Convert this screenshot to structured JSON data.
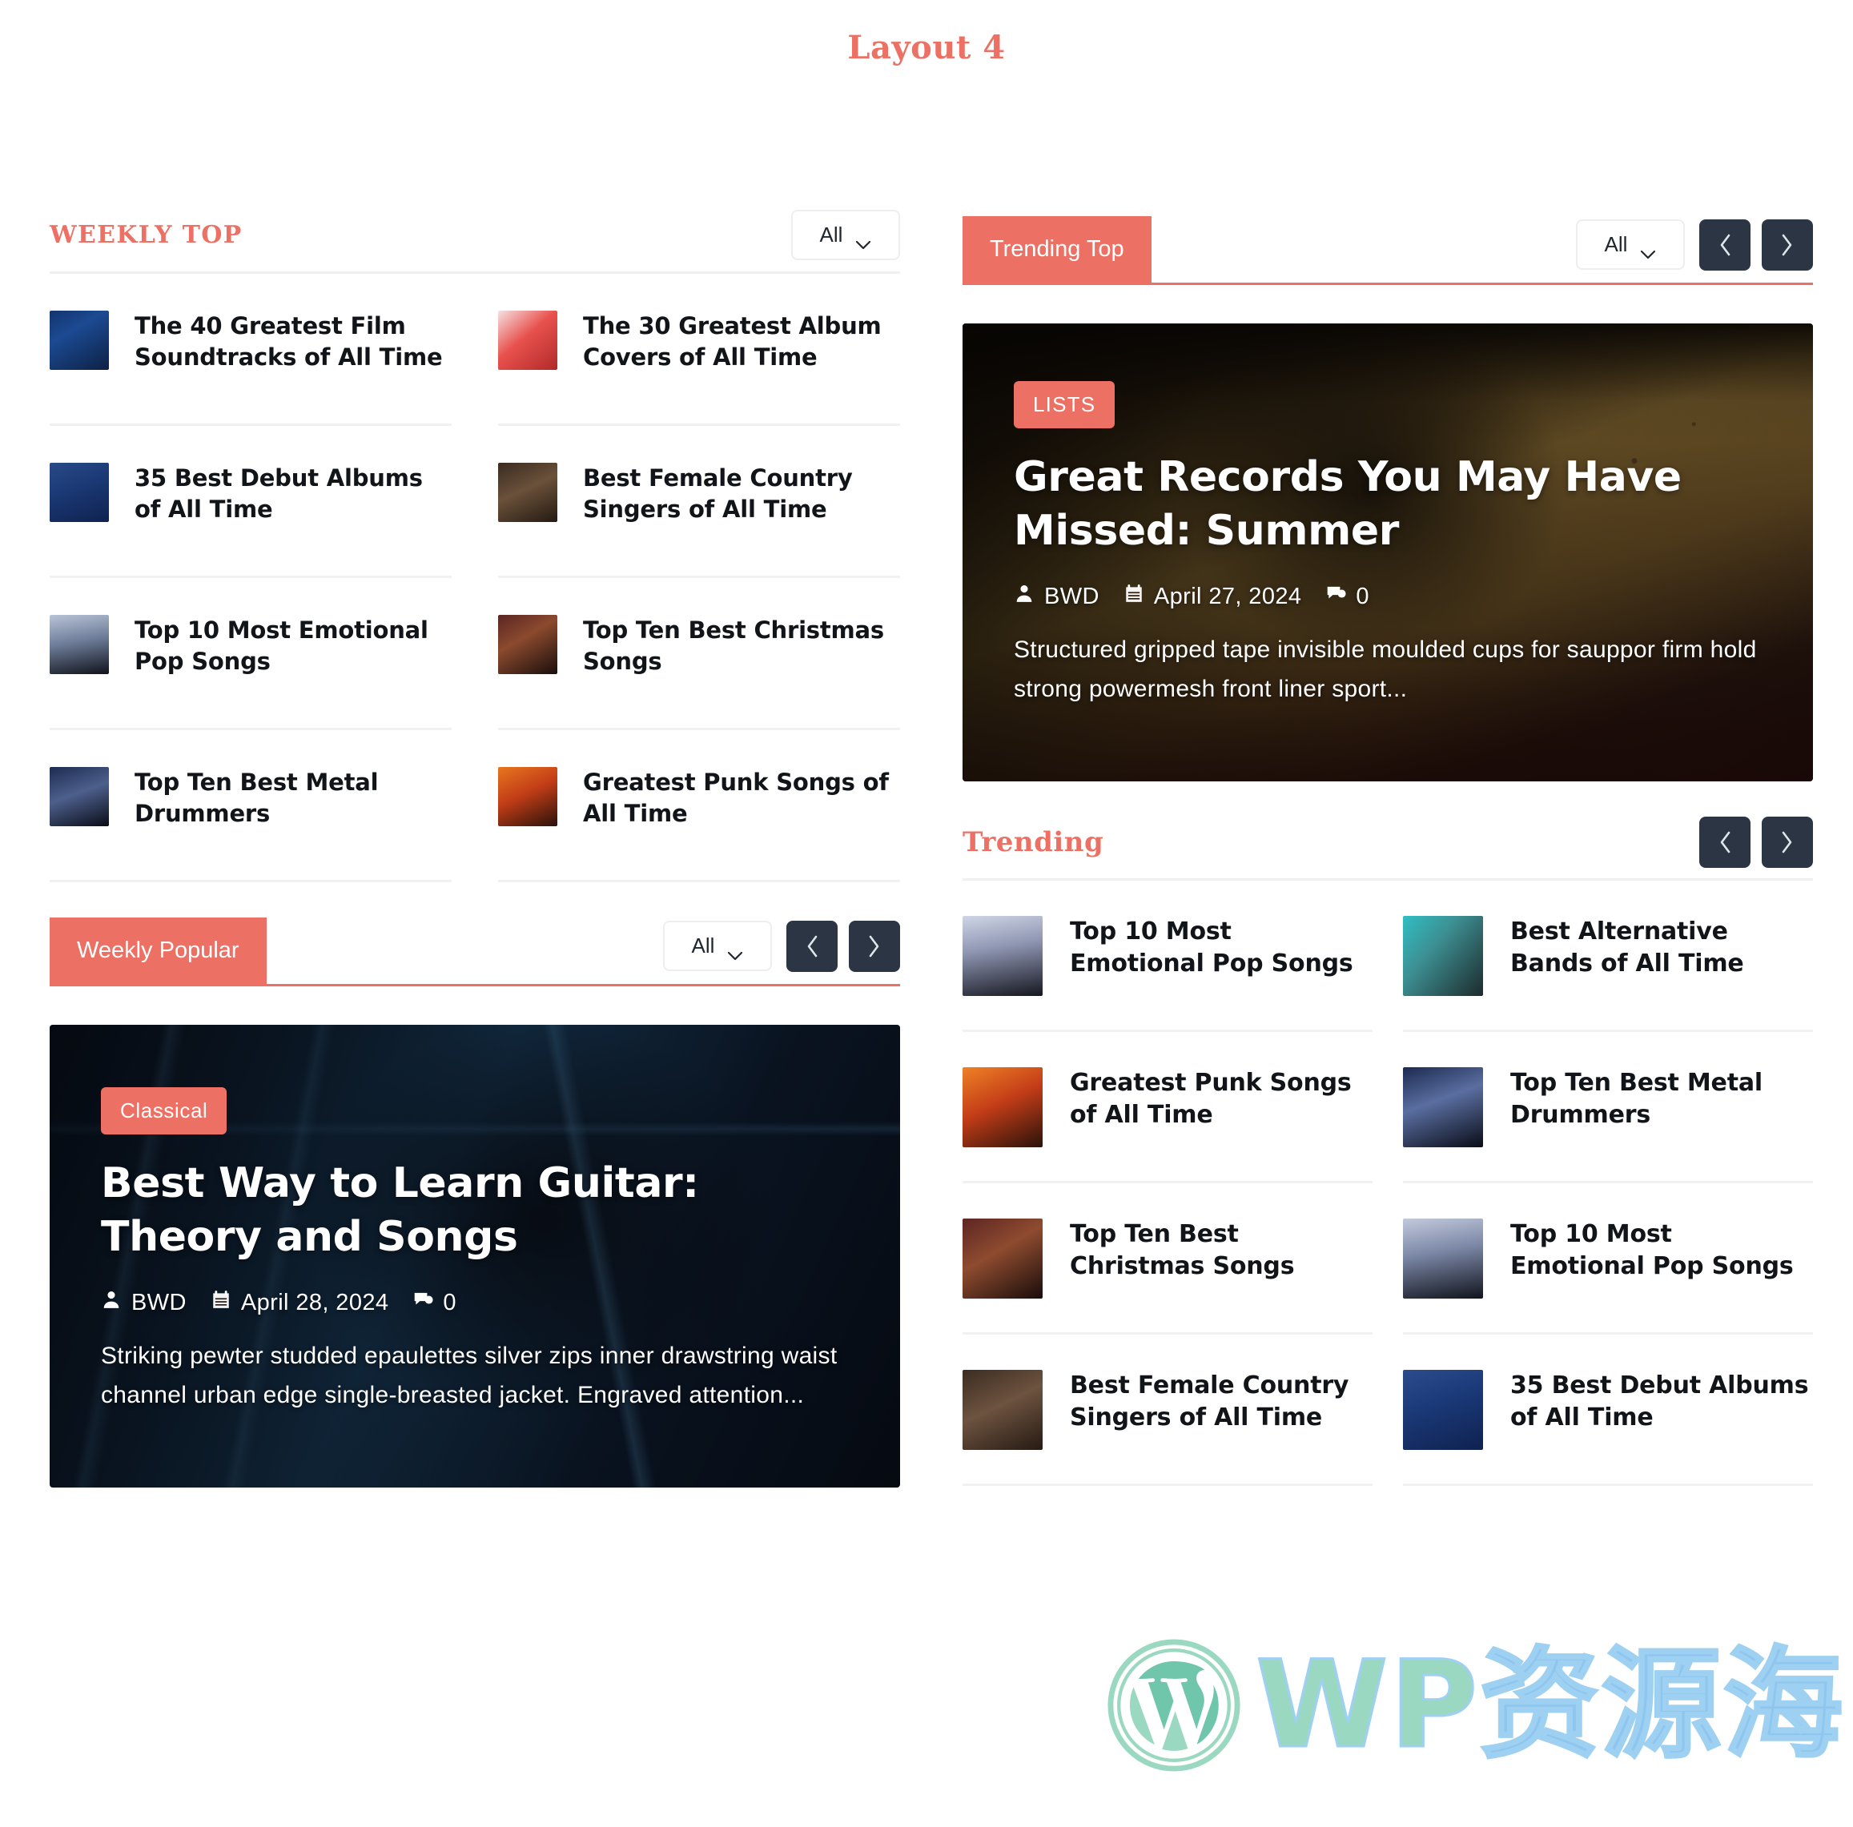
{
  "page": {
    "title": "Layout 4"
  },
  "colors": {
    "accent": "#ec7063",
    "nav_button": "#2b3544",
    "text": "#111418",
    "divider": "#f1f1f1"
  },
  "weekly_top": {
    "heading": "WEEKLY TOP",
    "filter": {
      "value": "All"
    },
    "items": [
      {
        "title": "The 40 Greatest Film Soundtracks of All Time",
        "thumb": "mixer-board-neon"
      },
      {
        "title": "The 30 Greatest Album Covers of All Time",
        "thumb": "singer-red-backdrop"
      },
      {
        "title": "35 Best Debut Albums of All Time",
        "thumb": "guitarist-blue-stage"
      },
      {
        "title": "Best Female Country Singers of All Time",
        "thumb": "dim-studio-stage"
      },
      {
        "title": "Top 10 Most Emotional Pop Songs",
        "thumb": "raised-hands-crowd"
      },
      {
        "title": "Top Ten Best Christmas Songs",
        "thumb": "guitarist-amp-red"
      },
      {
        "title": "Top Ten Best Metal Drummers",
        "thumb": "concert-lights-blue"
      },
      {
        "title": "Greatest Punk Songs of All Time",
        "thumb": "orange-crowd-lights"
      }
    ]
  },
  "weekly_popular": {
    "tab_label": "Weekly Popular",
    "filter": {
      "value": "All"
    },
    "prev_label": "Previous",
    "next_label": "Next",
    "hero": {
      "category": "Classical",
      "title": "Best Way to Learn Guitar: Theory and Songs",
      "author": "BWD",
      "date": "April 28, 2024",
      "comments": "0",
      "excerpt": "Striking pewter studded epaulettes silver zips inner drawstring waist channel urban edge single-breasted jacket. Engraved attention..."
    }
  },
  "trending_top": {
    "tab_label": "Trending Top",
    "filter": {
      "value": "All"
    },
    "prev_label": "Previous",
    "next_label": "Next",
    "hero": {
      "category": "LISTS",
      "title": "Great Records You May Have Missed: Summer",
      "author": "BWD",
      "date": "April 27, 2024",
      "comments": "0",
      "excerpt": "Structured gripped tape invisible moulded cups for sauppor firm hold strong powermesh front liner sport..."
    }
  },
  "trending": {
    "heading": "Trending",
    "prev_label": "Previous",
    "next_label": "Next",
    "items": [
      {
        "title": "Top 10 Most Emotional Pop Songs",
        "thumb": "raised-hands-crowd"
      },
      {
        "title": "Best Alternative Bands of All Time",
        "thumb": "singer-teal-mic"
      },
      {
        "title": "Greatest Punk Songs of All Time",
        "thumb": "orange-crowd-lights"
      },
      {
        "title": "Top Ten Best Metal Drummers",
        "thumb": "concert-lights-blue"
      },
      {
        "title": "Top Ten Best Christmas Songs",
        "thumb": "guitarist-amp-red"
      },
      {
        "title": "Top 10 Most Emotional Pop Songs",
        "thumb": "raised-hands-crowd"
      },
      {
        "title": "Best Female Country Singers of All Time",
        "thumb": "dim-studio-stage"
      },
      {
        "title": "35 Best Debut Albums of All Time",
        "thumb": "guitarist-blue-stage"
      }
    ]
  },
  "watermark": {
    "text": "WP资源海",
    "wp": "WP",
    "cn": "资源海"
  }
}
